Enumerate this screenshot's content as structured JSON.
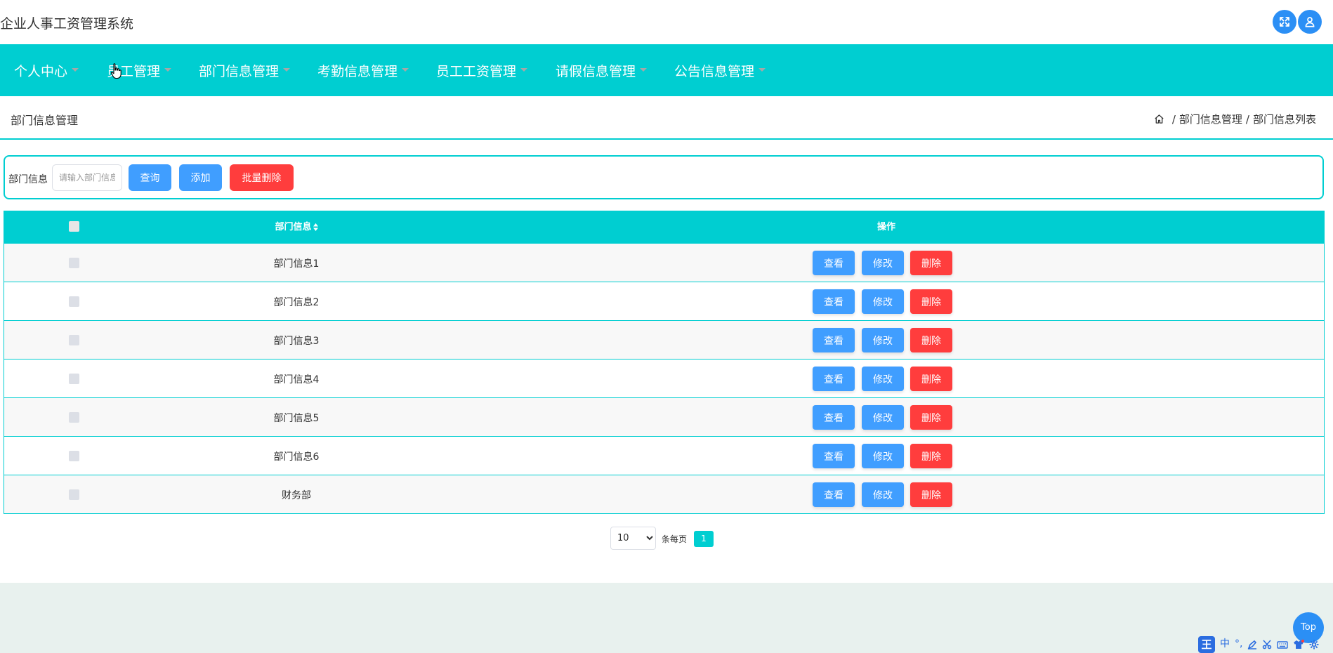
{
  "app": {
    "title": "企业人事工资管理系统"
  },
  "header": {
    "fullscreen_icon": "expand-icon",
    "user_icon": "user-icon"
  },
  "nav": {
    "items": [
      {
        "label": "个人中心"
      },
      {
        "label": "员工管理"
      },
      {
        "label": "部门信息管理"
      },
      {
        "label": "考勤信息管理"
      },
      {
        "label": "员工工资管理"
      },
      {
        "label": "请假信息管理"
      },
      {
        "label": "公告信息管理"
      }
    ]
  },
  "page": {
    "title": "部门信息管理",
    "breadcrumb": {
      "items": [
        "部门信息管理",
        "部门信息列表"
      ],
      "separator": "/"
    }
  },
  "search": {
    "label": "部门信息",
    "placeholder": "请输入部门信息",
    "value": "",
    "query_label": "查询",
    "add_label": "添加",
    "batch_delete_label": "批量删除"
  },
  "table": {
    "headers": {
      "name": "部门信息",
      "actions": "操作"
    },
    "rows": [
      {
        "name": "部门信息1"
      },
      {
        "name": "部门信息2"
      },
      {
        "name": "部门信息3"
      },
      {
        "name": "部门信息4"
      },
      {
        "name": "部门信息5"
      },
      {
        "name": "部门信息6"
      },
      {
        "name": "财务部"
      }
    ],
    "actions": {
      "view": "查看",
      "edit": "修改",
      "delete": "删除"
    }
  },
  "pagination": {
    "page_size": "10",
    "page_size_options": [
      "10"
    ],
    "per_page_label": "条每页",
    "current_page": "1"
  },
  "float": {
    "top_label": "Top"
  },
  "ime": {
    "logo": "王",
    "mode": "中",
    "punct": "°,",
    "icons": [
      "pen-icon",
      "scissors-icon",
      "keyboard-icon",
      "shirt-icon",
      "gear-icon"
    ]
  },
  "colors": {
    "primary": "#00ced1",
    "button_blue": "#409eff",
    "button_red": "#ff3d3d",
    "icon_blue": "#2b8ff5"
  }
}
